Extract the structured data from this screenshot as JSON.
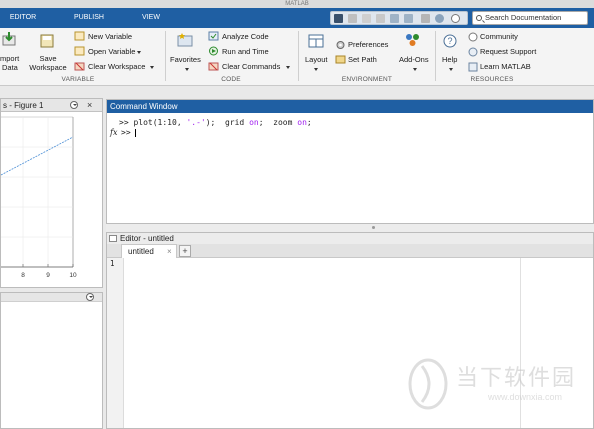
{
  "window": {
    "title": "MATLAB"
  },
  "tabs": [
    "EDITOR",
    "PUBLISH",
    "VIEW"
  ],
  "search": {
    "placeholder": "Search Documentation"
  },
  "ribbon": {
    "variable": {
      "import_label_line1": "mport",
      "import_label_line2": "Data",
      "save_label_line1": "Save",
      "save_label_line2": "Workspace",
      "new_variable": "New Variable",
      "open_variable": "Open Variable",
      "clear_workspace": "Clear Workspace",
      "group_label": "VARIABLE"
    },
    "code": {
      "favorites": "Favorites",
      "analyze_code": "Analyze Code",
      "run_and_time": "Run and Time",
      "clear_commands": "Clear Commands",
      "group_label": "CODE"
    },
    "environment": {
      "layout": "Layout",
      "preferences": "Preferences",
      "set_path": "Set Path",
      "add_ons": "Add-Ons",
      "group_label": "ENVIRONMENT"
    },
    "resources": {
      "help": "Help",
      "community": "Community",
      "request_support": "Request Support",
      "learn_matlab": "Learn MATLAB",
      "group_label": "RESOURCES"
    }
  },
  "figure_panel": {
    "title": "s - Figure 1",
    "x_ticks": [
      "8",
      "9",
      "10"
    ]
  },
  "command_window": {
    "title": "Command Window",
    "prompt": ">>",
    "line1": {
      "cmd_a": "plot(1:10, ",
      "str": "'.-'",
      "cmd_b": ");  grid ",
      "kw1": "on",
      "cmd_c": ";  zoom ",
      "kw2": "on",
      "cmd_d": ";"
    },
    "fx_label": "fx"
  },
  "editor": {
    "title": "Editor - untitled",
    "tab_label": "untitled",
    "line_number": "1"
  },
  "watermark": {
    "text_cn": "当下软件园",
    "text_url": "www.downxia.com"
  },
  "colors": {
    "accent_blue": "#1f5fa3",
    "keyword_purple": "#a020f0",
    "string_purple": "#a020f0"
  },
  "plot_data": {
    "series": "1:10",
    "style": ".-",
    "visible_x": [
      7.5,
      10
    ],
    "color": "#4c8fd6"
  }
}
